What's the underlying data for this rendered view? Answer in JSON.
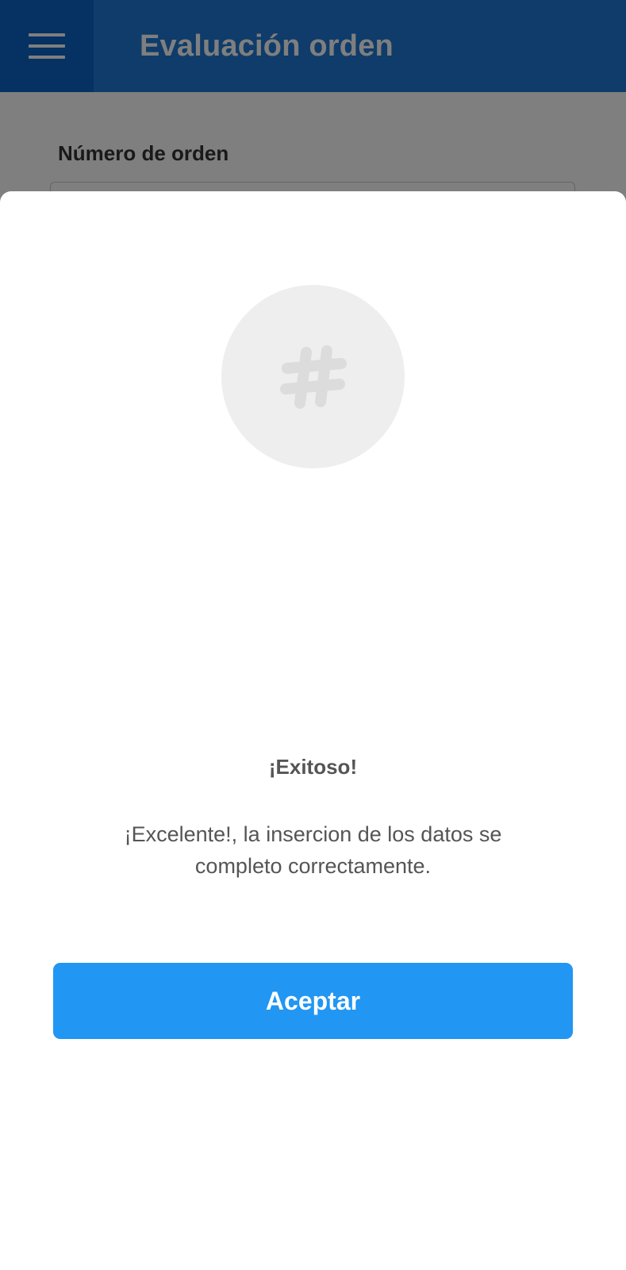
{
  "appbar": {
    "title": "Evaluación orden",
    "menu_icon": "hamburger-menu-icon",
    "color": "#1e78d4"
  },
  "form": {
    "order_number_label": "Número de orden",
    "order_number_value": ""
  },
  "dialog": {
    "icon": "hash-icon",
    "title": "¡Exitoso!",
    "message": "¡Excelente!, la insercion de los datos se completo correctamente.",
    "accept_label": "Aceptar",
    "accept_color": "#2196f3"
  }
}
